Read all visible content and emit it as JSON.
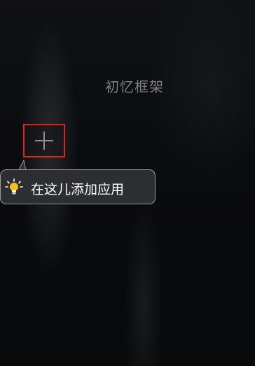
{
  "app": {
    "title": "初忆框架"
  },
  "add_button": {
    "icon": "plus-icon",
    "highlight_color": "#e2231a"
  },
  "tooltip": {
    "text": "在这儿添加应用",
    "icon": "lightbulb-icon"
  }
}
